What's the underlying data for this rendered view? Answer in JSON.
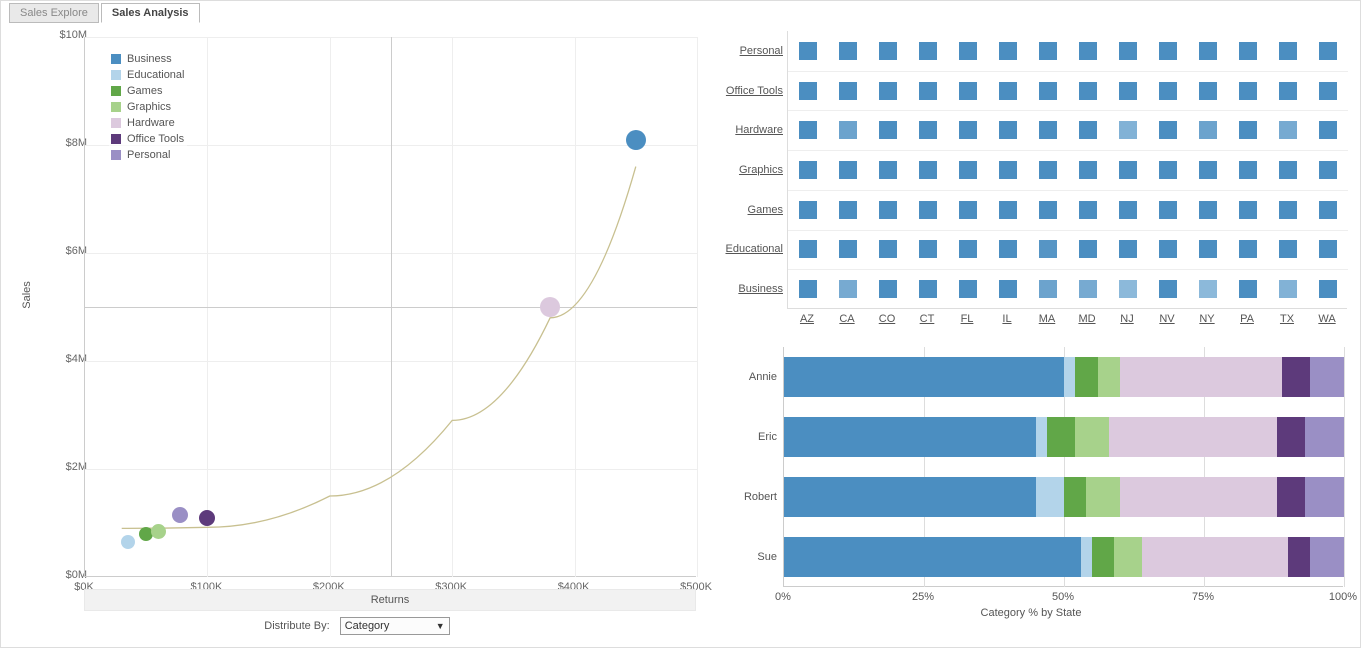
{
  "tabs": {
    "explore": "Sales Explore",
    "analysis": "Sales Analysis"
  },
  "categories": [
    {
      "name": "Business",
      "color": "#4b8ec1"
    },
    {
      "name": "Educational",
      "color": "#b3d4ea"
    },
    {
      "name": "Games",
      "color": "#61a748"
    },
    {
      "name": "Graphics",
      "color": "#a7d28b"
    },
    {
      "name": "Hardware",
      "color": "#dcc9de"
    },
    {
      "name": "Office Tools",
      "color": "#5d3a7b"
    },
    {
      "name": "Personal",
      "color": "#9a8fc5"
    }
  ],
  "scatter": {
    "yTitle": "Sales",
    "xTitle": "Returns",
    "yTicks": [
      "$0M",
      "$2M",
      "$4M",
      "$6M",
      "$8M",
      "$10M"
    ],
    "xTicks": [
      "$0K",
      "$100K",
      "$200K",
      "$300K",
      "$400K",
      "$500K"
    ],
    "yMax": 10,
    "xMax": 500,
    "refY": 5,
    "refX": 250
  },
  "distribute": {
    "label": "Distribute By:",
    "value": "Category"
  },
  "heatmap": {
    "rows": [
      "Personal",
      "Office Tools",
      "Hardware",
      "Graphics",
      "Games",
      "Educational",
      "Business"
    ],
    "cols": [
      "AZ",
      "CA",
      "CO",
      "CT",
      "FL",
      "IL",
      "MA",
      "MD",
      "NJ",
      "NV",
      "NY",
      "PA",
      "TX",
      "WA"
    ]
  },
  "stacked": {
    "people": [
      "Annie",
      "Eric",
      "Robert",
      "Sue"
    ],
    "xTicks": [
      "0%",
      "25%",
      "50%",
      "75%",
      "100%"
    ],
    "xTitle": "Category % by State"
  },
  "chart_data": [
    {
      "type": "scatter",
      "title": "",
      "xlabel": "Returns",
      "ylabel": "Sales",
      "xlim": [
        0,
        500000
      ],
      "ylim": [
        0,
        10000000
      ],
      "series": [
        {
          "name": "Business",
          "x": 450000,
          "y": 8100000,
          "size": 20,
          "color": "#4b8ec1"
        },
        {
          "name": "Educational",
          "x": 35000,
          "y": 650000,
          "size": 14,
          "color": "#b3d4ea"
        },
        {
          "name": "Games",
          "x": 50000,
          "y": 800000,
          "size": 14,
          "color": "#61a748"
        },
        {
          "name": "Graphics",
          "x": 60000,
          "y": 850000,
          "size": 15,
          "color": "#a7d28b"
        },
        {
          "name": "Hardware",
          "x": 380000,
          "y": 5000000,
          "size": 20,
          "color": "#dcc9de"
        },
        {
          "name": "Office Tools",
          "x": 100000,
          "y": 1100000,
          "size": 16,
          "color": "#5d3a7b"
        },
        {
          "name": "Personal",
          "x": 78000,
          "y": 1150000,
          "size": 16,
          "color": "#9a8fc5"
        }
      ],
      "reference_lines": {
        "x": 250000,
        "y": 5000000
      }
    },
    {
      "type": "heatmap",
      "rows": [
        "Personal",
        "Office Tools",
        "Hardware",
        "Graphics",
        "Games",
        "Educational",
        "Business"
      ],
      "cols": [
        "AZ",
        "CA",
        "CO",
        "CT",
        "FL",
        "IL",
        "MA",
        "MD",
        "NJ",
        "NV",
        "NY",
        "PA",
        "TX",
        "WA"
      ],
      "values": [
        [
          1.0,
          1.0,
          1.0,
          1.0,
          1.0,
          1.0,
          1.0,
          1.0,
          1.0,
          1.0,
          1.0,
          1.0,
          1.0,
          1.0
        ],
        [
          1.0,
          1.0,
          1.0,
          1.0,
          1.0,
          1.0,
          1.0,
          1.0,
          1.0,
          1.0,
          1.0,
          1.0,
          1.0,
          1.0
        ],
        [
          1.0,
          0.7,
          1.0,
          1.0,
          1.0,
          1.0,
          1.0,
          1.0,
          0.5,
          1.0,
          0.7,
          1.0,
          0.6,
          1.0
        ],
        [
          1.0,
          1.0,
          1.0,
          1.0,
          1.0,
          1.0,
          1.0,
          1.0,
          1.0,
          1.0,
          1.0,
          1.0,
          1.0,
          1.0
        ],
        [
          1.0,
          1.0,
          1.0,
          1.0,
          1.0,
          1.0,
          1.0,
          1.0,
          1.0,
          1.0,
          1.0,
          1.0,
          1.0,
          1.0
        ],
        [
          1.0,
          1.0,
          1.0,
          1.0,
          1.0,
          1.0,
          0.9,
          1.0,
          1.0,
          1.0,
          1.0,
          1.0,
          1.0,
          1.0
        ],
        [
          1.0,
          0.6,
          1.0,
          1.0,
          1.0,
          1.0,
          0.7,
          0.6,
          0.4,
          1.0,
          0.4,
          1.0,
          0.5,
          1.0
        ]
      ],
      "color_dark": "#4b8ec1",
      "color_light": "#b8d5ea"
    },
    {
      "type": "bar",
      "orientation": "horizontal-stacked-100",
      "xlabel": "Category % by State",
      "categories": [
        "Annie",
        "Eric",
        "Robert",
        "Sue"
      ],
      "segments": [
        "Business",
        "Educational",
        "Games",
        "Graphics",
        "Hardware",
        "Office Tools",
        "Personal"
      ],
      "colors": [
        "#4b8ec1",
        "#b3d4ea",
        "#61a748",
        "#a7d28b",
        "#dcc9de",
        "#5d3a7b",
        "#9a8fc5"
      ],
      "values": [
        [
          50,
          2,
          4,
          4,
          29,
          5,
          6
        ],
        [
          45,
          2,
          5,
          6,
          30,
          5,
          7
        ],
        [
          45,
          5,
          4,
          6,
          28,
          5,
          7
        ],
        [
          53,
          2,
          4,
          5,
          26,
          4,
          6
        ]
      ],
      "xlim": [
        0,
        100
      ]
    }
  ]
}
